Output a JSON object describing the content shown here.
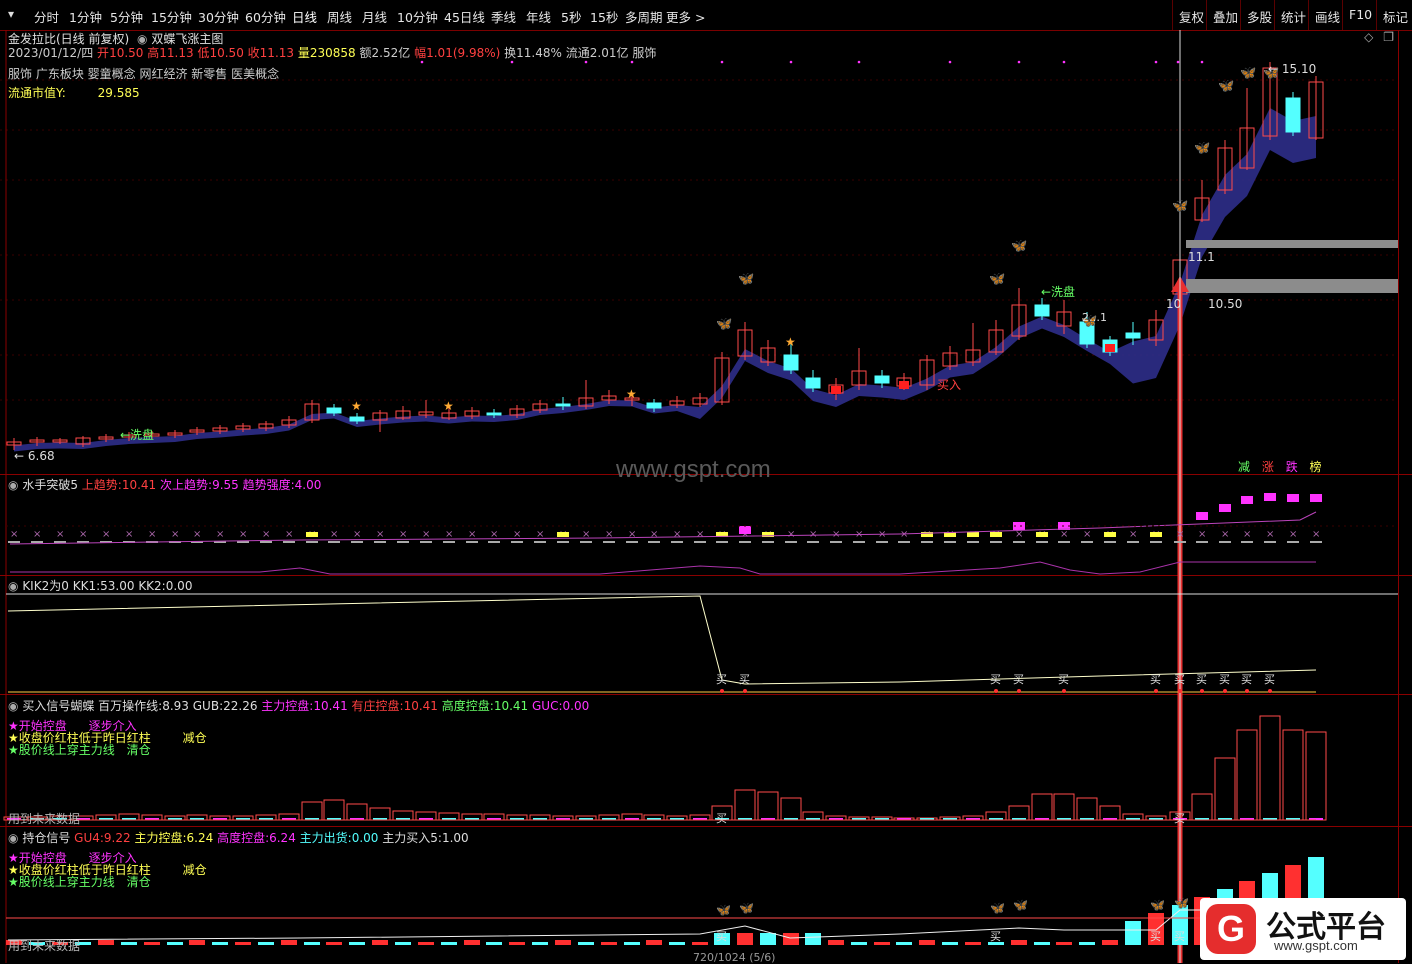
{
  "toolbar": {
    "periods": [
      "分时",
      "1分钟",
      "5分钟",
      "15分钟",
      "30分钟",
      "60分钟",
      "日线",
      "周线",
      "月线",
      "10分钟",
      "45日线",
      "季线",
      "年线",
      "5秒",
      "15秒",
      "多周期",
      "更多 >"
    ],
    "right": [
      "复权",
      "叠加",
      "多股",
      "统计",
      "画线",
      "F10",
      "标记"
    ]
  },
  "main": {
    "title": "金发拉比(日线 前复权)",
    "indicator": "双蝶飞涨主图",
    "date": "2023/01/12/四",
    "open_label": "开",
    "open": "10.50",
    "high_label": "高",
    "high": "11.13",
    "low_label": "低",
    "low": "10.50",
    "close_label": "收",
    "close": "11.13",
    "vol_label": "量",
    "vol": "230858",
    "amt_label": "额",
    "amt": "2.52亿",
    "chg_label": "幅",
    "chg": "1.01(9.98%)",
    "turn_label": "换",
    "turn": "11.48%",
    "float_label": "流通",
    "float": "2.01亿",
    "industry": "服饰",
    "concepts": "服饰 广东板块 婴童概念 网红经济 新零售 医美概念",
    "mcap_label": "流通市值Y:",
    "mcap": "29.585",
    "low_mark": "← 6.68",
    "high_mark": "← 15.10",
    "wash1": "←洗盘",
    "wash2": "←洗盘",
    "buy": "买入",
    "band_val1": "11.1",
    "band_val2": "10",
    "band_val3": "10.50",
    "watermark": "www.gspt.com",
    "right_tags": [
      "减",
      "涨",
      "跌",
      "榜"
    ],
    "candle_note": "2…1"
  },
  "panel2": {
    "name": "水手突破5",
    "f1_label": "上趋势:",
    "f1": "10.41",
    "f2_label": "次上趋势:",
    "f2": "9.55",
    "f3_label": "趋势强度:",
    "f3": "4.00"
  },
  "panel3": {
    "name": "KIK2为0",
    "f1_label": "KK1:",
    "f1": "53.00",
    "f2_label": "KK2:",
    "f2": "0.00",
    "buy_label": "买"
  },
  "panel4": {
    "name": "买入信号蝴蝶",
    "f1_label": "百万操作线:",
    "f1": "8.93",
    "f2_label": "GUB:",
    "f2": "22.26",
    "f3_label": "主力控盘:",
    "f3": "10.41",
    "f4_label": "有庄控盘:",
    "f4": "10.41",
    "f5_label": "高度控盘:",
    "f5": "10.41",
    "f6_label": "GUC:",
    "f6": "0.00",
    "legend1": "★开始控盘",
    "legend2": "逐步介入",
    "legend3": "★收盘价红柱低于昨日红柱",
    "legend4": "减仓",
    "legend5": "★股价线上穿主力线",
    "legend6": "清仓",
    "bottom": "用到未来数据",
    "buy_label": "买"
  },
  "panel5": {
    "name": "持仓信号",
    "f1_label": "GU4:",
    "f1": "9.22",
    "f2_label": "主力控盘:",
    "f2": "6.24",
    "f3_label": "高度控盘:",
    "f3": "6.24",
    "f4_label": "主力出货:",
    "f4": "0.00",
    "f5_label": "主力买入5:",
    "f5": "1.00",
    "legend1": "★开始控盘",
    "legend2": "逐步介入",
    "legend3": "★收盘价红柱低于昨日红柱",
    "legend4": "减仓",
    "legend5": "★股价线上穿主力线",
    "legend6": "清仓",
    "bottom": "用到未来数据",
    "buy_label": "买"
  },
  "logo": {
    "text": "公式平台",
    "url": "www.gspt.com"
  },
  "status": {
    "page": "720/1024 (5/6)"
  },
  "colors": {
    "up": "#ff3b3b",
    "down": "#54ffff",
    "grid": "#8a0000",
    "band": "#2a2a80",
    "magenta": "#ff33ff",
    "yellow": "#ffff44"
  }
}
